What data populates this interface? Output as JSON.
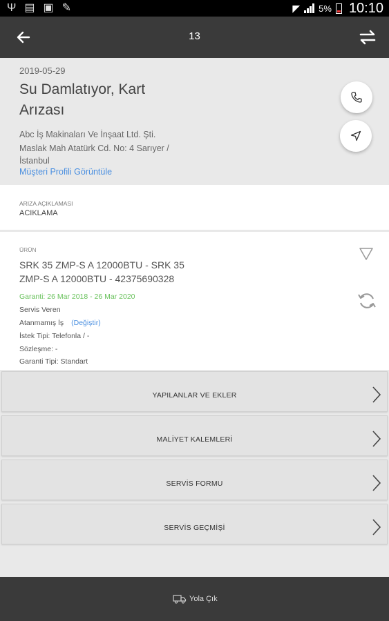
{
  "status_bar": {
    "battery_percent": "5%",
    "time": "10:10"
  },
  "app_bar": {
    "title": "13"
  },
  "job": {
    "date": "2019-05-29",
    "title": "Su Damlatıyor, Kart Arızası",
    "company": "Abc İş Makinaları Ve İnşaat Ltd. Şti.",
    "address": "Maslak Mah Atatürk Cd. No: 4 Sarıyer / İstanbul",
    "profile_link": "Müşteri Profili Görüntüle"
  },
  "description": {
    "label": "ARIZA AÇIKLAMASI",
    "value": "ACIKLAMA"
  },
  "product": {
    "label": "ÜRÜN",
    "name": "SRK 35 ZMP-S A 12000BTU - SRK 35 ZMP-S A 12000BTU - 42375690328",
    "warranty": "Garanti: 26 Mar 2018 - 26 Mar 2020",
    "service_provider": "Servis Veren",
    "assignment": "Atanmamış İş",
    "change_link": "(Değiştir)",
    "request_type": "İstek Tipi: Telefonla / -",
    "contract": "Sözleşme: -",
    "warranty_type": "Garanti Tipi: Standart"
  },
  "menu": [
    {
      "label": "YAPILANLAR VE EKLER"
    },
    {
      "label": "MALİYET KALEMLERİ"
    },
    {
      "label": "SERVİS FORMU"
    },
    {
      "label": "SERVİS GEÇMİŞİ"
    }
  ],
  "bottom_bar": {
    "action_label": "Yola Çık"
  },
  "colors": {
    "app_bar": "#3a3a3a",
    "link": "#4a8fe0",
    "warranty": "#67c15a"
  }
}
